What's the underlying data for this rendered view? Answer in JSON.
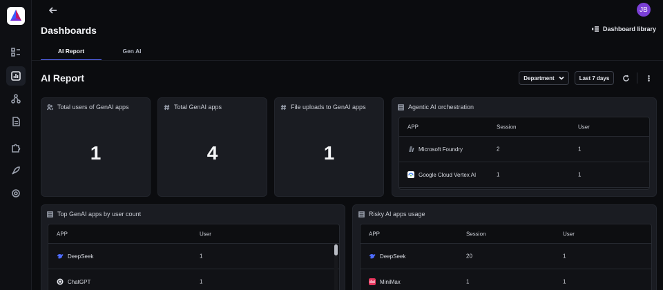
{
  "header": {
    "page_title": "Dashboards",
    "library_button": "Dashboard library",
    "avatar_initials": "JB"
  },
  "tabs": [
    {
      "label": "AI Report",
      "active": true
    },
    {
      "label": "Gen AI",
      "active": false
    }
  ],
  "report": {
    "title": "AI Report",
    "department_filter": "Department",
    "date_range": "Last 7 days"
  },
  "metrics": [
    {
      "title": "Total users of GenAI apps",
      "icon": "users-icon",
      "value": "1"
    },
    {
      "title": "Total GenAI apps",
      "icon": "hash-icon",
      "value": "4"
    },
    {
      "title": "File uploads to GenAI apps",
      "icon": "hash-icon",
      "value": "1"
    }
  ],
  "agentic": {
    "title": "Agentic AI orchestration",
    "columns": [
      "APP",
      "Session",
      "User"
    ],
    "rows": [
      {
        "app": "Microsoft Foundry",
        "session": "2",
        "user": "1",
        "icon_color": "#6f7580"
      },
      {
        "app": "Google Cloud Vertex AI",
        "session": "1",
        "user": "1",
        "icon_color": "#4285f4"
      }
    ]
  },
  "top_apps": {
    "title": "Top GenAI apps by user count",
    "columns": [
      "APP",
      "User"
    ],
    "rows": [
      {
        "app": "DeepSeek",
        "user": "1",
        "icon_color": "#4d6bfe"
      },
      {
        "app": "ChatGPT",
        "user": "1",
        "icon_color": "#e6e8ee"
      }
    ]
  },
  "risky": {
    "title": "Risky AI apps usage",
    "columns": [
      "APP",
      "Session",
      "User"
    ],
    "rows": [
      {
        "app": "DeepSeek",
        "session": "20",
        "user": "1",
        "icon_color": "#4d6bfe"
      },
      {
        "app": "MiniMax",
        "session": "1",
        "user": "1",
        "icon_color": "#e8365d"
      }
    ]
  },
  "colors": {
    "accent": "#5b6cff",
    "avatar": "#7b3fd6",
    "background": "#0b0c0f",
    "card": "#1a1c22"
  },
  "rail_icons": [
    "dashboard-list-icon",
    "bar-chart-icon",
    "network-icon",
    "document-icon",
    "puzzle-icon",
    "rocket-icon",
    "settings-icon"
  ]
}
